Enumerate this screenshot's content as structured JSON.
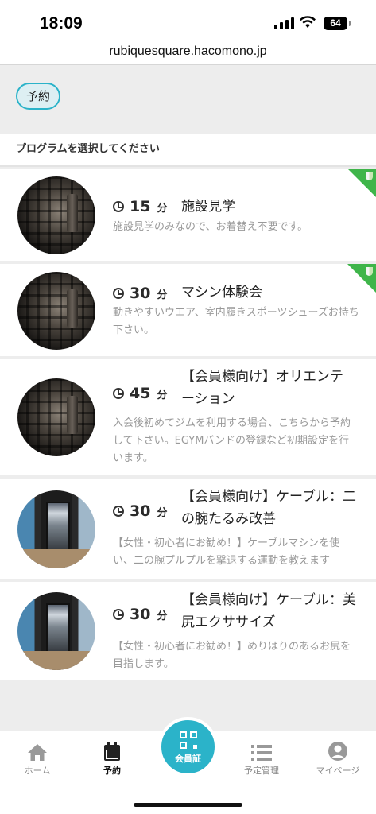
{
  "status_bar": {
    "time": "18:09",
    "battery": "64"
  },
  "browser": {
    "url": "rubiquesquare.hacomono.jp"
  },
  "tab_chip": {
    "label": "予約"
  },
  "section": {
    "heading": "プログラムを選択してください"
  },
  "programs": [
    {
      "duration": "15",
      "unit": "分",
      "title": "施設見学",
      "description": "施設見学のみなので、お着替え不要です。",
      "beginner_badge": true,
      "thumbnail": "dark-gym-window"
    },
    {
      "duration": "30",
      "unit": "分",
      "title": "マシン体験会",
      "description": "動きやすいウエア、室内履きスポーツシューズお持ち下さい。",
      "beginner_badge": true,
      "thumbnail": "dark-gym-window"
    },
    {
      "duration": "45",
      "unit": "分",
      "title": "【会員様向け】オリエンテーション",
      "description": "入会後初めてジムを利用する場合、こちらから予約して下さい。EGYMバンドの登録など初期設定を行います。",
      "beginner_badge": false,
      "thumbnail": "dark-gym-window"
    },
    {
      "duration": "30",
      "unit": "分",
      "title": "【会員様向け】ケーブル：二の腕たるみ改善",
      "description": "【女性・初心者にお勧め！】ケーブルマシンを使い、二の腕プルプルを撃退する運動を教えます",
      "beginner_badge": false,
      "thumbnail": "cable-machine"
    },
    {
      "duration": "30",
      "unit": "分",
      "title": "【会員様向け】ケーブル：美尻エクササイズ",
      "description": "【女性・初心者にお勧め！】めりはりのあるお尻を目指します。",
      "beginner_badge": false,
      "thumbnail": "cable-machine"
    }
  ],
  "bottom_nav": {
    "home": "ホーム",
    "reserve": "予約",
    "member_card": "会員証",
    "schedule": "予定管理",
    "mypage": "マイページ"
  },
  "colors": {
    "accent": "#2bb3c9",
    "badge_green": "#3fb54a"
  }
}
